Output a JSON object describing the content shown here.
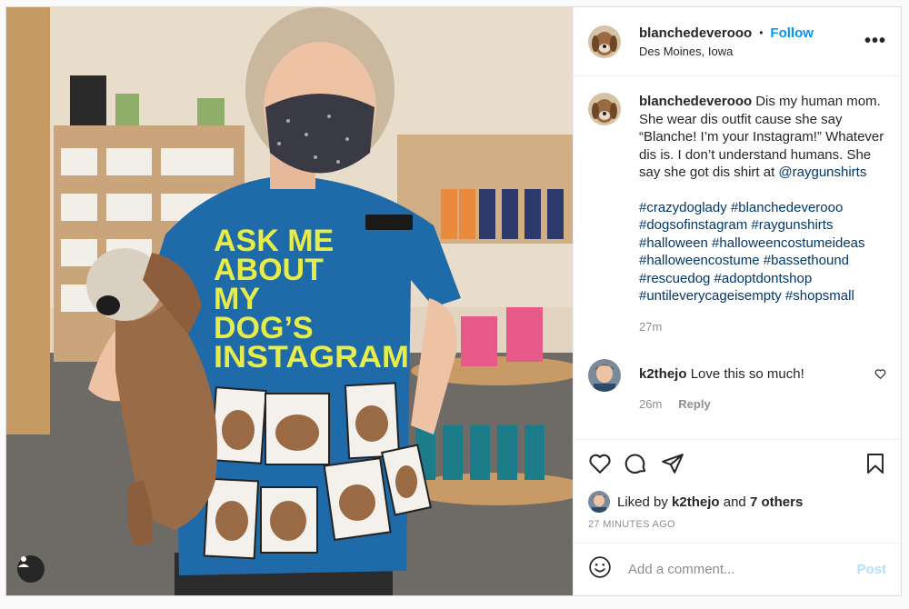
{
  "post": {
    "author": "blanchedeverooo",
    "follow_label": "Follow",
    "separator": "•",
    "location": "Des Moines, Iowa",
    "more_label": "•••",
    "caption": {
      "username": "blanchedeverooo",
      "text": "Dis my human mom. She wear dis outfit cause she say “Blanche! I’m your Instagram!” Whatever dis is. I don’t understand humans. She say she got dis shirt at ",
      "mention": "@raygunshirts",
      "hashtags": "#crazydoglady #blanchedeverooo #dogsofinstagram #raygunshirts #halloween #halloweencostumeideas #halloweencostume #bassethound #rescuedog #adoptdontshop #untileverycageisempty #shopsmall",
      "age": "27m"
    },
    "comments": [
      {
        "username": "k2thejo",
        "text": "Love this so much!",
        "age": "26m",
        "reply_label": "Reply"
      }
    ],
    "likes": {
      "prefix": "Liked by ",
      "user": "k2thejo",
      "middle": " and ",
      "others": "7 others"
    },
    "timestamp": "27 MINUTES AGO",
    "add_comment_placeholder": "Add a comment...",
    "post_label": "Post",
    "photo": {
      "shirt_lines": [
        "ASK ME",
        "ABOUT",
        "MY",
        "DOG’S",
        "INSTAGRAM"
      ]
    }
  },
  "colors": {
    "accent": "#0095f6",
    "link": "#00376b",
    "muted": "#8e8e8e",
    "shirt": "#1f6aa8",
    "shirt_text": "#e6ec4a"
  }
}
